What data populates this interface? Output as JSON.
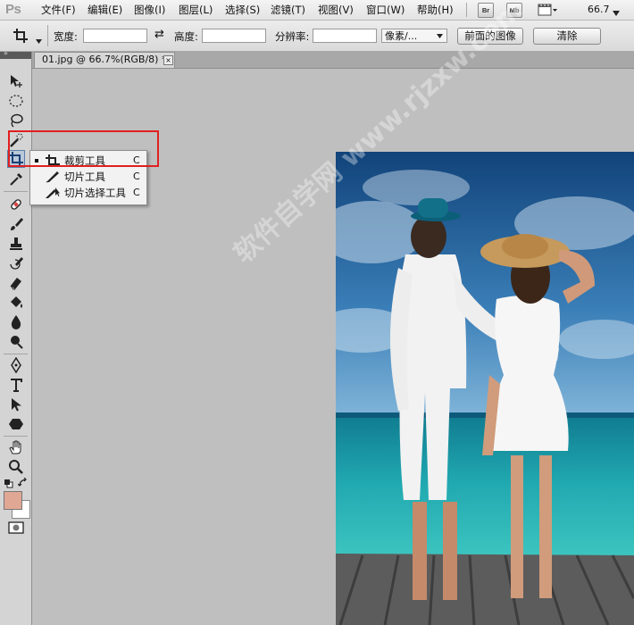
{
  "app": {
    "logo": "Ps"
  },
  "menu": {
    "items": [
      "文件(F)",
      "编辑(E)",
      "图像(I)",
      "图层(L)",
      "选择(S)",
      "滤镜(T)",
      "视图(V)",
      "窗口(W)",
      "帮助(H)"
    ],
    "bridge_label": "Br",
    "minibridge_label": "Mb",
    "zoom": "66.7"
  },
  "options": {
    "width_label": "宽度:",
    "width_value": "",
    "swap_symbol": "⇄",
    "height_label": "高度:",
    "height_value": "",
    "resolution_label": "分辨率:",
    "resolution_value": "",
    "unit_value": "像素/...",
    "front_image_label": "前面的图像",
    "clear_label": "清除"
  },
  "document": {
    "tab_title": "01.jpg @ 66.7%(RGB/8) *",
    "close_symbol": "×"
  },
  "flyout": {
    "items": [
      {
        "label": "裁剪工具",
        "key": "C",
        "selected": true
      },
      {
        "label": "切片工具",
        "key": "C",
        "selected": false
      },
      {
        "label": "切片选择工具",
        "key": "C",
        "selected": false
      }
    ]
  },
  "tools": [
    "move-icon",
    "marquee-icon",
    "lasso-icon",
    "quick-select-icon",
    "crop-icon",
    "eyedropper-icon",
    "healing-brush-icon",
    "brush-icon",
    "clone-stamp-icon",
    "history-brush-icon",
    "eraser-icon",
    "paint-bucket-icon",
    "blur-icon",
    "dodge-icon",
    "pen-icon",
    "type-icon",
    "path-select-icon",
    "shape-icon",
    "hand-icon",
    "zoom-icon",
    "quick-mask-icon"
  ],
  "colors": {
    "foreground": "#e0a894",
    "background": "#ffffff",
    "highlight": "#e02020"
  },
  "watermark": "软件自学网 www.rjzxw.com"
}
